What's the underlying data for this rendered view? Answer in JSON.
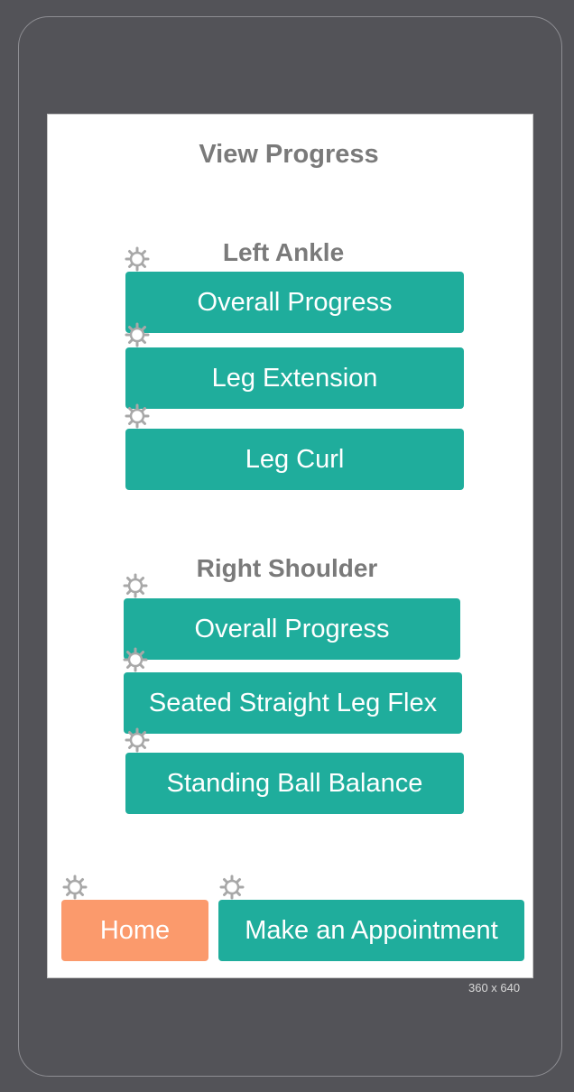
{
  "page": {
    "title": "View Progress",
    "device_size_label": "360 x 640"
  },
  "sections": [
    {
      "heading": "Left Ankle",
      "buttons": [
        "Overall Progress",
        "Leg Extension",
        "Leg Curl"
      ]
    },
    {
      "heading": "Right Shoulder",
      "buttons": [
        "Overall Progress",
        "Seated Straight Leg Flex",
        "Standing Ball Balance"
      ]
    }
  ],
  "footer": {
    "home_label": "Home",
    "appointment_label": "Make an Appointment"
  },
  "icons": {
    "settings": "gear-icon"
  },
  "colors": {
    "background": "#535358",
    "screen": "#ffffff",
    "primary_button": "#1fad9c",
    "home_button": "#fb9a6c",
    "heading_text": "#7a7a7a",
    "gear": "#a8a8a8"
  }
}
